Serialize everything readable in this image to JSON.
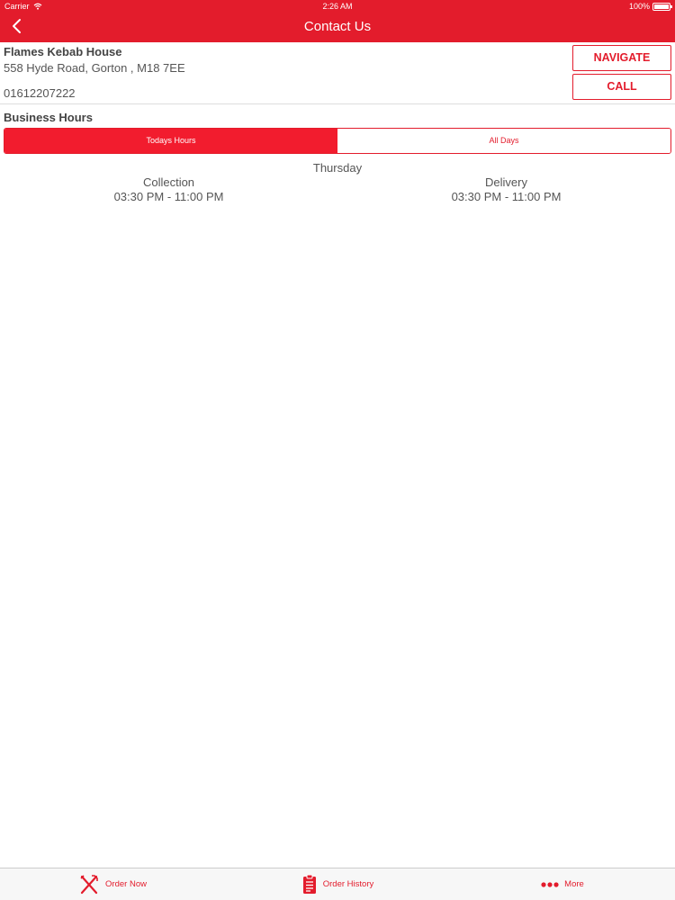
{
  "status_bar": {
    "carrier": "Carrier",
    "time": "2:26 AM",
    "battery": "100%",
    "battery_level": 1.0
  },
  "nav": {
    "title": "Contact Us",
    "back_icon": "chevron-left-icon"
  },
  "store": {
    "name": "Flames Kebab House",
    "address": "558 Hyde Road, Gorton , M18 7EE",
    "phone": "01612207222"
  },
  "actions": {
    "navigate_label": "NAVIGATE",
    "call_label": "CALL"
  },
  "business_hours": {
    "title": "Business Hours",
    "tabs": [
      {
        "label": "Todays Hours",
        "selected": true
      },
      {
        "label": "All Days",
        "selected": false
      }
    ],
    "day": "Thursday",
    "services": [
      {
        "name": "Collection",
        "hours": "03:30 PM - 11:00 PM"
      },
      {
        "name": "Delivery",
        "hours": "03:30 PM - 11:00 PM"
      }
    ]
  },
  "tab_bar": {
    "items": [
      {
        "label": "Order Now",
        "icon": "fork-knife-icon"
      },
      {
        "label": "Order History",
        "icon": "clipboard-icon"
      },
      {
        "label": "More",
        "icon": "more-dots-icon"
      }
    ]
  },
  "colors": {
    "accent": "#e31c2c",
    "segment_active": "#f21c2e",
    "text": "#555555",
    "tab_bar_bg": "#f7f7f7"
  }
}
